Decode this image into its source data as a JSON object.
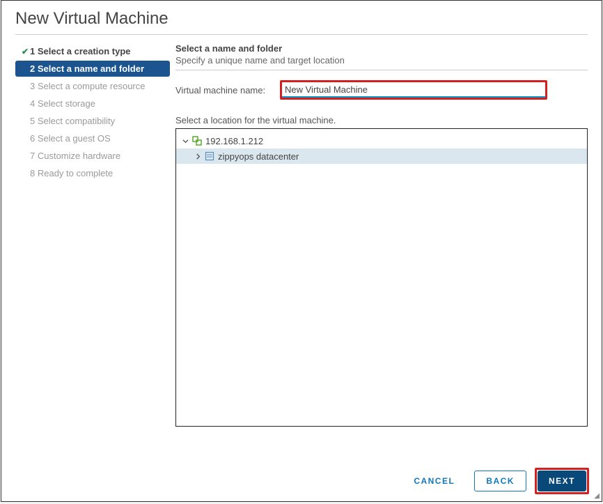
{
  "title": "New Virtual Machine",
  "steps": [
    {
      "label": "1 Select a creation type",
      "state": "done"
    },
    {
      "label": "2 Select a name and folder",
      "state": "active"
    },
    {
      "label": "3 Select a compute resource",
      "state": "future"
    },
    {
      "label": "4 Select storage",
      "state": "future"
    },
    {
      "label": "5 Select compatibility",
      "state": "future"
    },
    {
      "label": "6 Select a guest OS",
      "state": "future"
    },
    {
      "label": "7 Customize hardware",
      "state": "future"
    },
    {
      "label": "8 Ready to complete",
      "state": "future"
    }
  ],
  "section": {
    "title": "Select a name and folder",
    "subtitle": "Specify a unique name and target location"
  },
  "vm_name": {
    "label": "Virtual machine name:",
    "value": "New Virtual Machine"
  },
  "location": {
    "label": "Select a location for the virtual machine.",
    "root": "192.168.1.212",
    "datacenter": "zippyops datacenter"
  },
  "footer": {
    "cancel": "CANCEL",
    "back": "BACK",
    "next": "NEXT"
  }
}
